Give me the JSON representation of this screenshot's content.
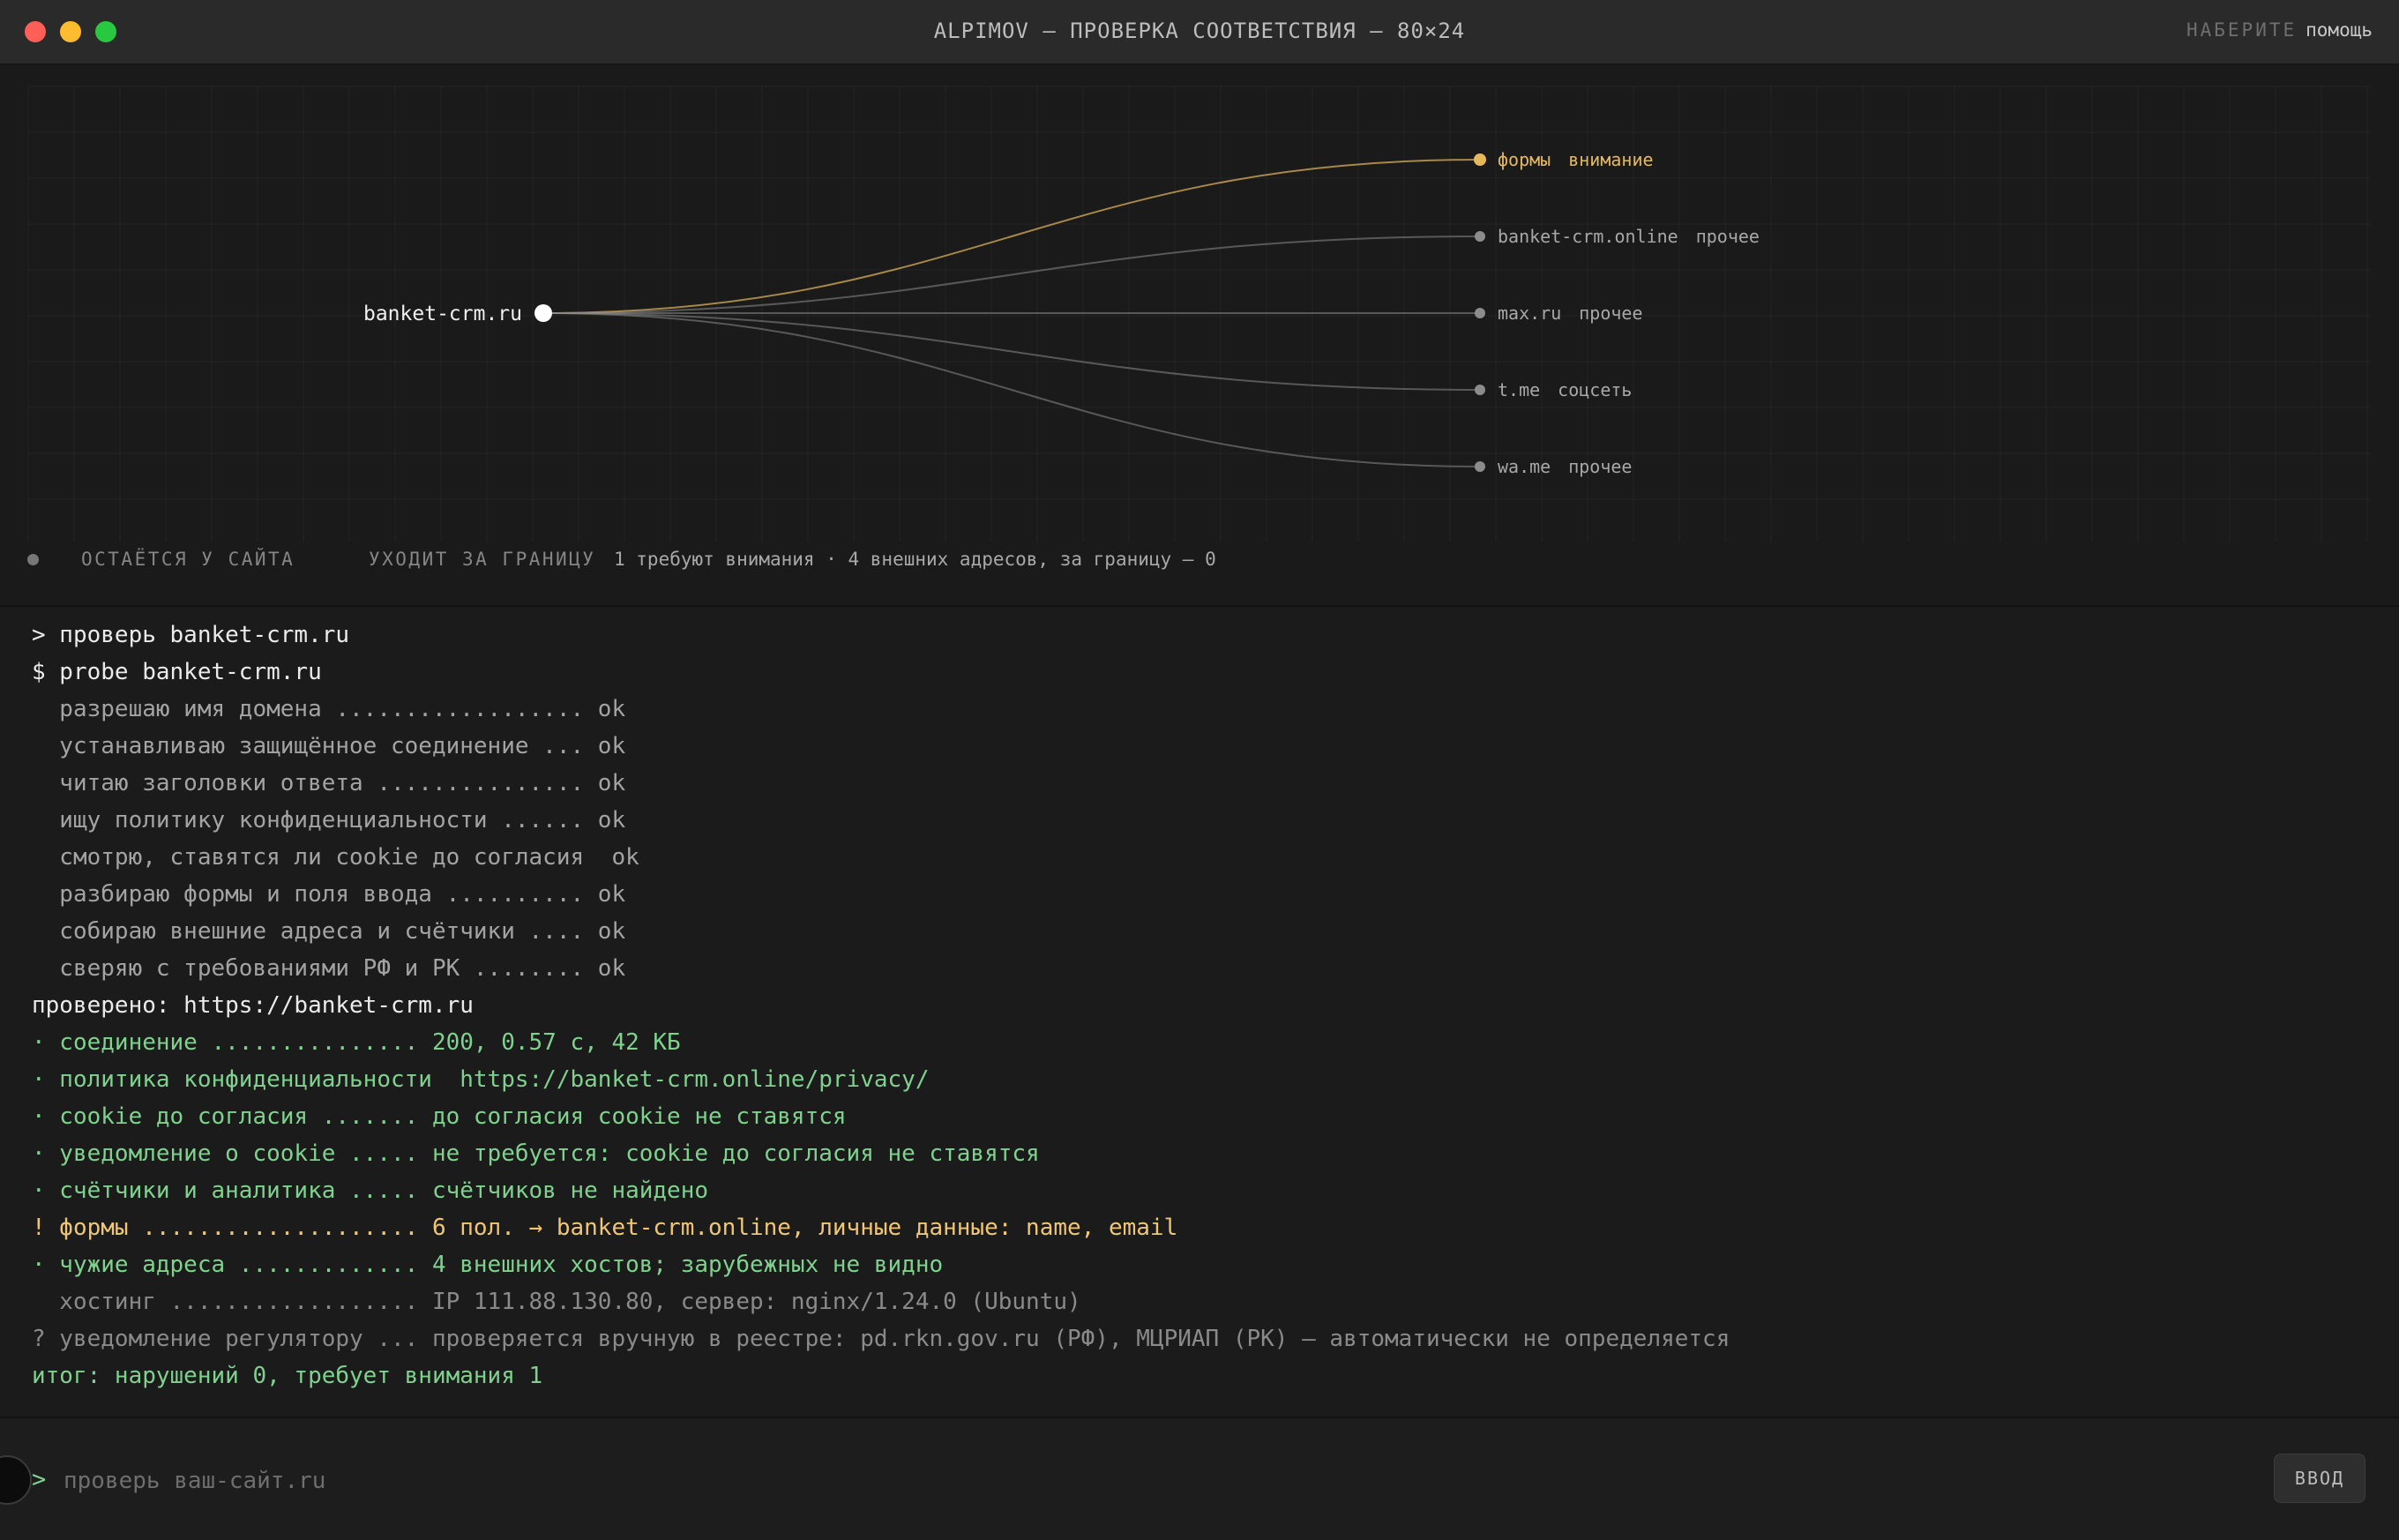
{
  "window": {
    "title": "ALPIMOV — ПРОВЕРКА СООТВЕТСТВИЯ — 80×24",
    "hint_key": "НАБЕРИТЕ",
    "hint_action": "помощь"
  },
  "graph": {
    "source": "banket-crm.ru",
    "targets": [
      {
        "host": "формы",
        "tag": "внимание",
        "status": "attention"
      },
      {
        "host": "banket-crm.online",
        "tag": "прочее",
        "status": "normal"
      },
      {
        "host": "max.ru",
        "tag": "прочее",
        "status": "normal"
      },
      {
        "host": "t.me",
        "tag": "соцсеть",
        "status": "normal"
      },
      {
        "host": "wa.me",
        "tag": "прочее",
        "status": "normal"
      }
    ],
    "legend": {
      "stays": "ОСТАЁТСЯ У САЙТА",
      "abroad": "УХОДИТ ЗА ГРАНИЦУ",
      "summary": "1 требуют внимания · 4 внешних адресов, за границу — 0"
    },
    "colors": {
      "attention": "#e6b85c",
      "normal": "#8c8c8c",
      "source": "#ffffff"
    }
  },
  "terminal": {
    "lines": [
      {
        "text": "> проверь banket-crm.ru",
        "style": "white"
      },
      {
        "text": "$ probe banket-crm.ru",
        "style": "white"
      },
      {
        "text": "  разрешаю имя домена .................. ok",
        "style": "gray"
      },
      {
        "text": "  устанавливаю защищённое соединение ... ok",
        "style": "gray"
      },
      {
        "text": "  читаю заголовки ответа ............... ok",
        "style": "gray"
      },
      {
        "text": "  ищу политику конфиденциальности ...... ok",
        "style": "gray"
      },
      {
        "text": "  смотрю, ставятся ли cookie до согласия  ok",
        "style": "gray"
      },
      {
        "text": "  разбираю формы и поля ввода .......... ok",
        "style": "gray"
      },
      {
        "text": "  собираю внешние адреса и счётчики .... ok",
        "style": "gray"
      },
      {
        "text": "  сверяю с требованиями РФ и РК ........ ok",
        "style": "gray"
      },
      {
        "text": "проверено: https://banket-crm.ru",
        "style": "white"
      },
      {
        "text": "· соединение ............... 200, 0.57 с, 42 КБ",
        "style": "green"
      },
      {
        "text": "· политика конфиденциальности  https://banket-crm.online/privacy/",
        "style": "green"
      },
      {
        "text": "· cookie до согласия ....... до согласия cookie не ставятся",
        "style": "green"
      },
      {
        "text": "· уведомление о cookie ..... не требуется: cookie до согласия не ставятся",
        "style": "green"
      },
      {
        "text": "· счётчики и аналитика ..... счётчиков не найдено",
        "style": "green"
      },
      {
        "text": "! формы .................... 6 пол. → banket-crm.online, личные данные: name, email",
        "style": "yellow"
      },
      {
        "text": "· чужие адреса ............. 4 внешних хостов; зарубежных не видно",
        "style": "green"
      },
      {
        "text": "  хостинг .................. IP 111.88.130.80, сервер: nginx/1.24.0 (Ubuntu)",
        "style": "dim"
      },
      {
        "text": "? уведомление регулятору ... проверяется вручную в реестре: pd.rkn.gov.ru (РФ), МЦРИАП (РК) — автоматически не определяется",
        "style": "dim"
      },
      {
        "text": "итог: нарушений 0, требует внимания 1",
        "style": "green"
      }
    ]
  },
  "input": {
    "prompt": ">",
    "placeholder": "проверь ваш-сайт.ru",
    "value": "",
    "button": "ВВОД"
  }
}
